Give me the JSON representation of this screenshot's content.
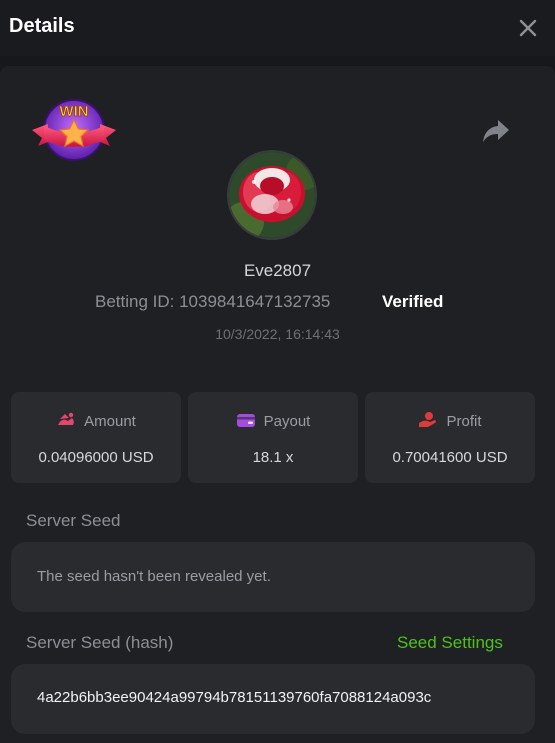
{
  "header": {
    "title": "Details"
  },
  "badge": {
    "text": "WIN"
  },
  "user": {
    "name": "Eve2807",
    "betting_id": "Betting ID: 1039841647132735",
    "verified": "Verified",
    "timestamp": "10/3/2022, 16:14:43"
  },
  "stats": [
    {
      "label": "Amount",
      "value": "0.04096000 USD",
      "icon": "amount-icon",
      "color": "#e8456b"
    },
    {
      "label": "Payout",
      "value": "18.1 x",
      "icon": "wallet-icon",
      "color": "#a24dde"
    },
    {
      "label": "Profit",
      "value": "0.70041600 USD",
      "icon": "profit-hand-icon",
      "color": "#e03a3a"
    }
  ],
  "server_seed": {
    "label": "Server Seed",
    "text": "The seed hasn't been revealed yet."
  },
  "server_seed_hash": {
    "label": "Server Seed (hash)",
    "settings_link": "Seed Settings",
    "value": "4a22b6bb3ee90424a99794b78151139760fa7088124a093c"
  },
  "colors": {
    "accent_green": "#4cc21b",
    "panel": "#1f2023",
    "card": "#2a2b2f"
  }
}
